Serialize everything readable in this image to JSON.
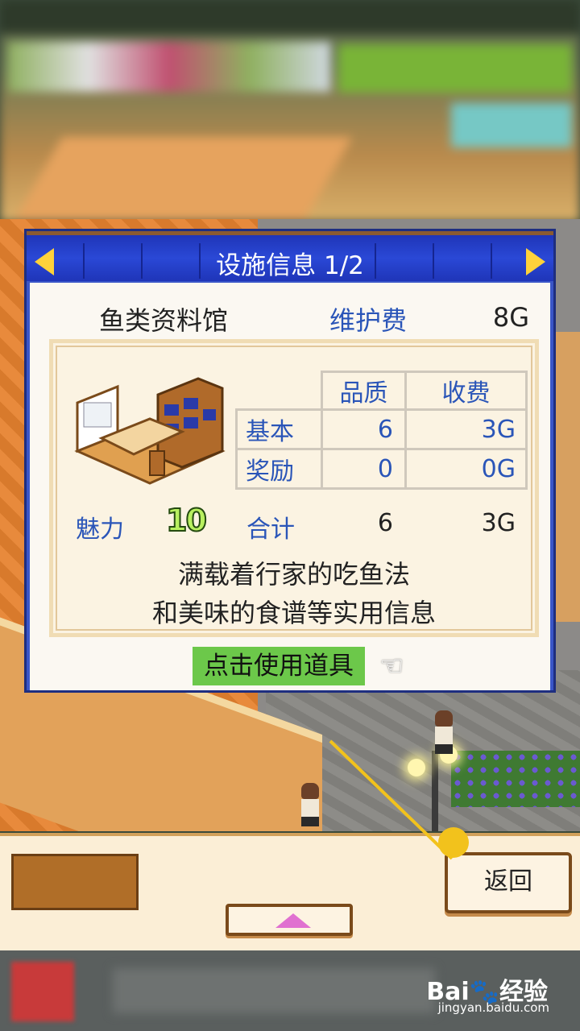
{
  "dialog": {
    "title": "设施信息 1/2",
    "facility_name": "鱼类资料馆",
    "upkeep_label": "维护费",
    "upkeep_value": "8G",
    "table": {
      "headers": [
        "品质",
        "收费"
      ],
      "rows": [
        {
          "label": "基本",
          "quality": "6",
          "fee": "3G"
        },
        {
          "label": "奖励",
          "quality": "0",
          "fee": "0G"
        }
      ]
    },
    "charm_label": "魅力",
    "charm_value": "10",
    "total_label": "合计",
    "total_quality": "6",
    "total_fee": "3G",
    "description": [
      "满载着行家的吃鱼法",
      "和美味的食谱等实用信息"
    ],
    "use_item_label": "点击使用道具",
    "hand_icon": "☜"
  },
  "bottom_bar": {
    "back_label": "返回"
  },
  "footer": {
    "watermark": "Bai🐾经验",
    "watermark_url": "jingyan.baidu.com"
  },
  "colors": {
    "header_blue": "#2a48d6",
    "label_blue": "#2a55b8",
    "use_item_green": "#6cc84a",
    "annotation_yellow": "#f2c21c"
  }
}
